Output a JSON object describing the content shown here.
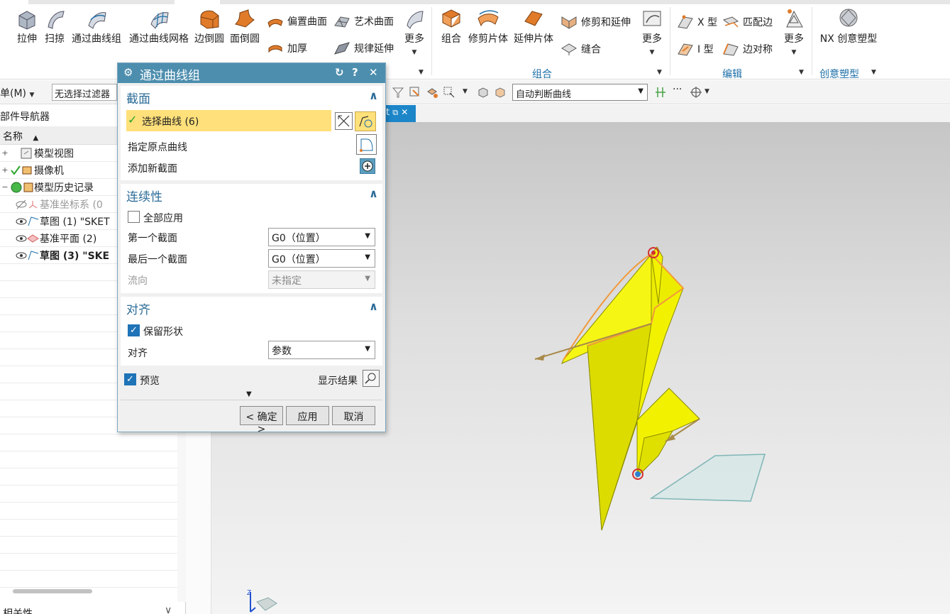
{
  "ribbon": {
    "large_buttons": [
      {
        "label": "拉伸",
        "icon": "extrude-icon"
      },
      {
        "label": "扫掠",
        "icon": "swept-icon"
      },
      {
        "label": "通过曲线组",
        "icon": "through-curves-icon"
      },
      {
        "label": "通过曲线网格",
        "icon": "through-curve-mesh-icon"
      },
      {
        "label": "边倒圆",
        "icon": "edge-blend-icon"
      },
      {
        "label": "面倒圆",
        "icon": "face-blend-icon"
      }
    ],
    "small_buttons_col1": [
      {
        "label": "偏置曲面",
        "icon": "offset-surface-icon"
      },
      {
        "label": "加厚",
        "icon": "thicken-icon"
      }
    ],
    "small_buttons_col2": [
      {
        "label": "艺术曲面",
        "icon": "studio-surface-icon"
      },
      {
        "label": "规律延伸",
        "icon": "law-extension-icon"
      }
    ],
    "more_label": "更多",
    "combine_group": {
      "label": "组合",
      "buttons": [
        {
          "label": "组合",
          "icon": "combine-icon"
        },
        {
          "label": "修剪片体",
          "icon": "trim-sheet-icon"
        },
        {
          "label": "延伸片体",
          "icon": "extend-sheet-icon"
        }
      ],
      "small_buttons": [
        {
          "label": "修剪和延伸",
          "icon": "trim-extend-icon"
        },
        {
          "label": "缝合",
          "icon": "sew-icon"
        }
      ],
      "more_label": "更多"
    },
    "edit_group": {
      "label": "编辑",
      "small_col1": [
        {
          "label": "X 型",
          "icon": "x-form-icon"
        },
        {
          "label": "I 型",
          "icon": "i-form-icon"
        }
      ],
      "small_col2": [
        {
          "label": "匹配边",
          "icon": "match-edge-icon"
        },
        {
          "label": "边对称",
          "icon": "edge-symmetry-icon"
        }
      ],
      "more_label": "更多"
    },
    "nx_group": {
      "label": "创意塑型",
      "button_label": "NX 创意塑型"
    }
  },
  "toolbar2": {
    "menu_label": "菜单(M)",
    "filter": "无选择过滤器",
    "curve_rule": "自动判断曲线"
  },
  "navigator": {
    "title": "部件导航器",
    "column_name": "名称",
    "rows": [
      {
        "toggle": "+",
        "label": "模型视图",
        "icon": "model-views-icon",
        "style": "normal"
      },
      {
        "toggle": "+",
        "label": "摄像机",
        "icon": "cameras-icon",
        "style": "normal"
      },
      {
        "toggle": "−",
        "label": "模型历史记录",
        "icon": "model-history-icon",
        "style": "normal"
      },
      {
        "toggle": "",
        "label": "基准坐标系 (0",
        "icon": "datum-csys-icon",
        "style": "dim"
      },
      {
        "toggle": "",
        "label": "草图 (1) \"SKET",
        "icon": "sketch-icon",
        "style": "normal"
      },
      {
        "toggle": "",
        "label": "基准平面 (2)",
        "icon": "datum-plane-icon",
        "style": "normal"
      },
      {
        "toggle": "",
        "label": "草图 (3) \"SKE",
        "icon": "sketch-icon",
        "style": "bold"
      }
    ],
    "related_label": "相关性"
  },
  "tab": {
    "label": "t"
  },
  "dialog": {
    "title": "通过曲线组",
    "section_section": {
      "header": "截面",
      "select_curve": "选择曲线 (6)",
      "specify_origin": "指定原点曲线",
      "add_section": "添加新截面"
    },
    "section_continuity": {
      "header": "连续性",
      "apply_all": "全部应用",
      "apply_all_checked": false,
      "first_label": "第一个截面",
      "first_value": "G0（位置）",
      "last_label": "最后一个截面",
      "last_value": "G0（位置）",
      "flow_label": "流向",
      "flow_value": "未指定"
    },
    "section_alignment": {
      "header": "对齐",
      "preserve_shape": "保留形状",
      "preserve_shape_checked": true,
      "align_label": "对齐",
      "align_value": "参数"
    },
    "preview_label": "预览",
    "preview_checked": true,
    "show_result": "显示结果",
    "ok_label": "< 确定 >",
    "apply_label": "应用",
    "cancel_label": "取消"
  },
  "colors": {
    "accent": "#4d8eae",
    "selection_highlight": "#ffe07a",
    "surface_yellow": "#f2f200",
    "tab_blue": "#1c86c9",
    "group_label": "#1d6fa8"
  }
}
